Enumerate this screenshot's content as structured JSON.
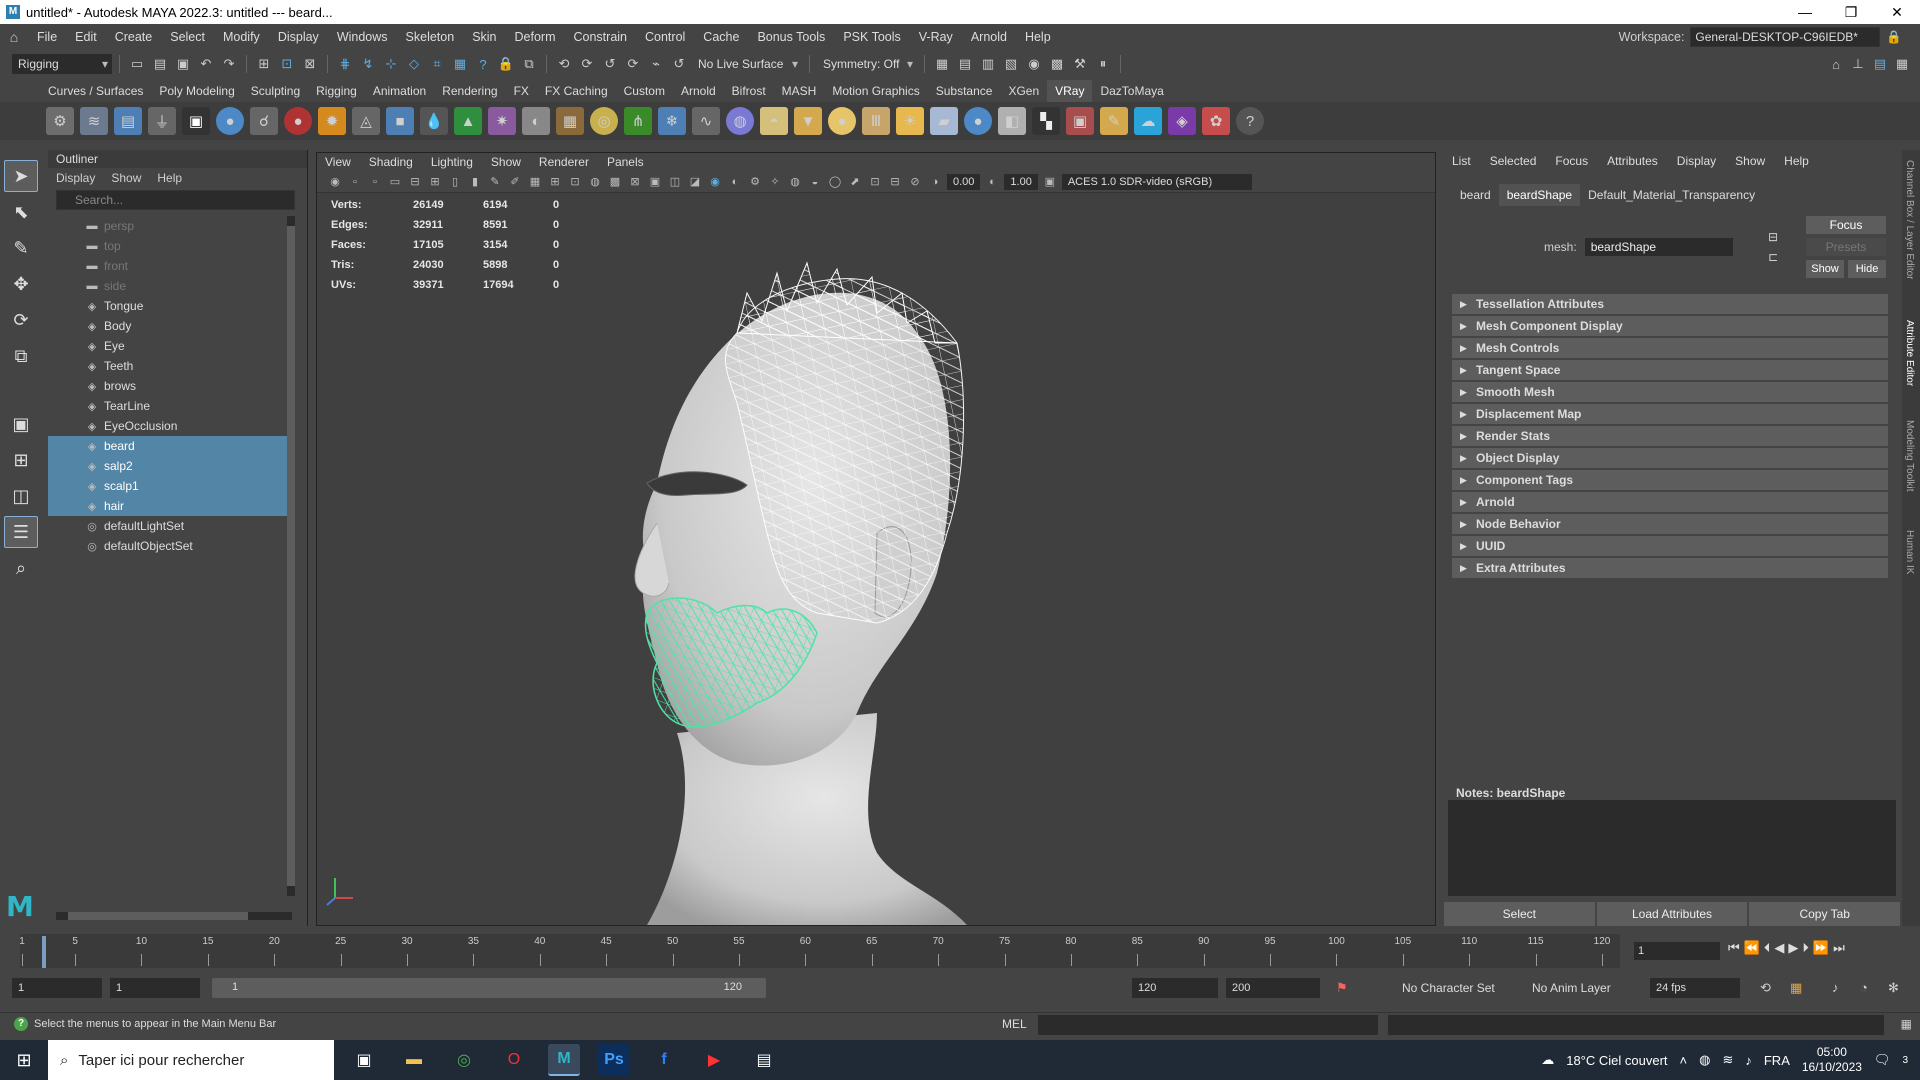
{
  "window": {
    "title": "untitled* - Autodesk MAYA 2022.3: untitled   ---   beard...",
    "app_icon": "M"
  },
  "menubar": {
    "items": [
      "File",
      "Edit",
      "Create",
      "Select",
      "Modify",
      "Display",
      "Windows",
      "Skeleton",
      "Skin",
      "Deform",
      "Constrain",
      "Control",
      "Cache",
      "Bonus Tools",
      "PSK Tools",
      "V-Ray",
      "Arnold",
      "Help"
    ],
    "workspace_label": "Workspace:",
    "workspace_value": "General-DESKTOP-C96IEDB*"
  },
  "statusline": {
    "mode": "Rigging",
    "live_surface": "No Live Surface",
    "symmetry": "Symmetry: Off"
  },
  "shelf": {
    "tabs": [
      "Curves / Surfaces",
      "Poly Modeling",
      "Sculpting",
      "Rigging",
      "Animation",
      "Rendering",
      "FX",
      "FX Caching",
      "Custom",
      "Arnold",
      "Bifrost",
      "MASH",
      "Motion Graphics",
      "Substance",
      "XGen",
      "VRay",
      "DazToMaya"
    ],
    "active_tab": "VRay"
  },
  "outliner": {
    "title": "Outliner",
    "menu": [
      "Display",
      "Show",
      "Help"
    ],
    "search_placeholder": "Search...",
    "items": [
      {
        "label": "persp",
        "kind": "camera",
        "selected": false
      },
      {
        "label": "top",
        "kind": "camera",
        "selected": false
      },
      {
        "label": "front",
        "kind": "camera",
        "selected": false
      },
      {
        "label": "side",
        "kind": "camera",
        "selected": false
      },
      {
        "label": "Tongue",
        "kind": "mesh",
        "selected": false
      },
      {
        "label": "Body",
        "kind": "mesh",
        "selected": false
      },
      {
        "label": "Eye",
        "kind": "mesh",
        "selected": false
      },
      {
        "label": "Teeth",
        "kind": "mesh",
        "selected": false
      },
      {
        "label": "brows",
        "kind": "mesh",
        "selected": false
      },
      {
        "label": "TearLine",
        "kind": "mesh",
        "selected": false
      },
      {
        "label": "EyeOcclusion",
        "kind": "mesh",
        "selected": false
      },
      {
        "label": "beard",
        "kind": "mesh",
        "selected": true
      },
      {
        "label": "salp2",
        "kind": "mesh",
        "selected": true
      },
      {
        "label": "scalp1",
        "kind": "mesh",
        "selected": true
      },
      {
        "label": "hair",
        "kind": "mesh",
        "selected": true
      },
      {
        "label": "defaultLightSet",
        "kind": "set",
        "selected": false
      },
      {
        "label": "defaultObjectSet",
        "kind": "set",
        "selected": false
      }
    ]
  },
  "viewport": {
    "menu": [
      "View",
      "Shading",
      "Lighting",
      "Show",
      "Renderer",
      "Panels"
    ],
    "exposure": "0.00",
    "gamma": "1.00",
    "color_space": "ACES 1.0 SDR-video (sRGB)",
    "hud": [
      {
        "label": "Verts:",
        "a": "26149",
        "b": "6194",
        "c": "0"
      },
      {
        "label": "Edges:",
        "a": "32911",
        "b": "8591",
        "c": "0"
      },
      {
        "label": "Faces:",
        "a": "17105",
        "b": "3154",
        "c": "0"
      },
      {
        "label": "Tris:",
        "a": "24030",
        "b": "5898",
        "c": "0"
      },
      {
        "label": "UVs:",
        "a": "39371",
        "b": "17694",
        "c": "0"
      }
    ]
  },
  "attribute_editor": {
    "menu": [
      "List",
      "Selected",
      "Focus",
      "Attributes",
      "Display",
      "Show",
      "Help"
    ],
    "tabs": [
      "beard",
      "beardShape",
      "Default_Material_Transparency"
    ],
    "active_tab": "beardShape",
    "mesh_label": "mesh:",
    "mesh_value": "beardShape",
    "focus_btn": "Focus",
    "presets_btn": "Presets",
    "show_btn": "Show",
    "hide_btn": "Hide",
    "sections": [
      "Tessellation Attributes",
      "Mesh Component Display",
      "Mesh Controls",
      "Tangent Space",
      "Smooth Mesh",
      "Displacement Map",
      "Render Stats",
      "Object Display",
      "Component Tags",
      "Arnold",
      "Node Behavior",
      "UUID",
      "Extra Attributes"
    ],
    "notes_label": "Notes:  beardShape",
    "buttons": [
      "Select",
      "Load Attributes",
      "Copy Tab"
    ]
  },
  "right_tabs": [
    "Channel Box / Layer Editor",
    "Attribute Editor",
    "Modeling Toolkit",
    "Human IK"
  ],
  "timeline": {
    "ticks": [
      1,
      5,
      10,
      15,
      20,
      25,
      30,
      35,
      40,
      45,
      50,
      55,
      60,
      65,
      70,
      75,
      80,
      85,
      90,
      95,
      100,
      105,
      110,
      115,
      120
    ],
    "labels": [
      "1",
      "5",
      "10",
      "15",
      "20",
      "25",
      "30",
      "35",
      "40",
      "45",
      "50",
      "55",
      "60",
      "65",
      "70",
      "75",
      "80",
      "85",
      "90",
      "95",
      "100",
      "105",
      "110",
      "115",
      "120"
    ],
    "current_frame": "1"
  },
  "range": {
    "start": "1",
    "inner_start": "1",
    "bar_start": "1",
    "bar_end": "120",
    "end": "120",
    "anim_end": "200",
    "character_set": "No Character Set",
    "anim_layer": "No Anim Layer",
    "fps": "24 fps"
  },
  "cmdline": {
    "help_text": "Select the menus to appear in the Main Menu Bar",
    "mel": "MEL"
  },
  "taskbar": {
    "search_text": "Taper ici pour rechercher",
    "weather": "18°C  Ciel couvert",
    "lang": "FRA",
    "time": "05:00",
    "date": "16/10/2023",
    "notifications": "3"
  },
  "colors": {
    "selection": "#5285a6",
    "beard_wire": "#4fe3a6",
    "accent": "#5ab0e6"
  }
}
